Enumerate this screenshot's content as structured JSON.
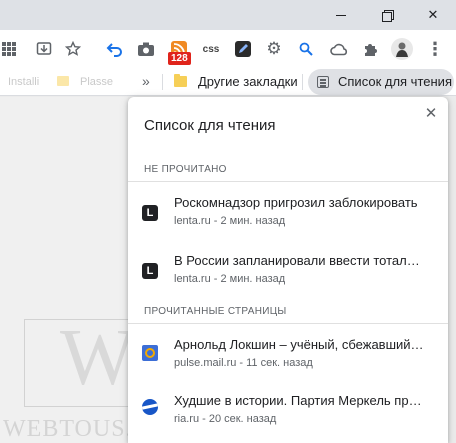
{
  "window": {
    "minimize_icon": "minimize-icon",
    "restore_icon": "restore-icon",
    "close_icon": "close-icon"
  },
  "toolbar": {
    "extensions": [
      {
        "name": "apps-grid-icon",
        "glyph": "▦"
      },
      {
        "name": "install-app-icon",
        "glyph": "⤓"
      },
      {
        "name": "bookmark-star-icon",
        "glyph": "☆"
      },
      {
        "name": "undo-arrow-icon",
        "glyph": "↶"
      },
      {
        "name": "camera-icon",
        "glyph": "⬛"
      },
      {
        "name": "rss-icon",
        "glyph": ")"
      },
      {
        "name": "css-icon",
        "glyph": "css"
      },
      {
        "name": "edit-icon",
        "glyph": "✎"
      },
      {
        "name": "settings-gear-icon",
        "glyph": "⚙"
      },
      {
        "name": "search-icon",
        "glyph": "🔍"
      },
      {
        "name": "cloud-icon",
        "glyph": "☁"
      },
      {
        "name": "extensions-puzzle-icon",
        "glyph": "✚"
      },
      {
        "name": "profile-avatar-icon",
        "glyph": "☺"
      },
      {
        "name": "menu-dots-icon",
        "glyph": "⋮"
      }
    ],
    "rss_badge": "128"
  },
  "bookmarks_bar": {
    "faded_items": [
      "Installi",
      "Plasse"
    ],
    "overflow_label": "»",
    "other_bookmarks_label": "Другие закладки",
    "reading_list_label": "Список для чтения"
  },
  "reading_list": {
    "title": "Список для чтения",
    "unread_header": "НЕ ПРОЧИТАНО",
    "read_header": "ПРОЧИТАННЫЕ СТРАНИЦЫ",
    "unread_items": [
      {
        "title": "Роскомнадзор пригрозил заблокировать",
        "meta": "lenta.ru - 2 мин. назад",
        "favicon": "L"
      },
      {
        "title": "В России запланировали ввести тотальный",
        "meta": "lenta.ru - 2 мин. назад",
        "favicon": "L"
      }
    ],
    "read_items": [
      {
        "title": "Арнольд Локшин – учёный, сбежавший в СССР",
        "meta": "pulse.mail.ru - 11 сек. назад",
        "favicon": "mail-ru-icon"
      },
      {
        "title": "Худшие в истории. Партия Меркель проиграла",
        "meta": "ria.ru - 20 сек. назад",
        "favicon": "ria-globe-icon"
      }
    ]
  },
  "watermark": {
    "letter": "W",
    "text": "WEBTOUS.RU"
  }
}
